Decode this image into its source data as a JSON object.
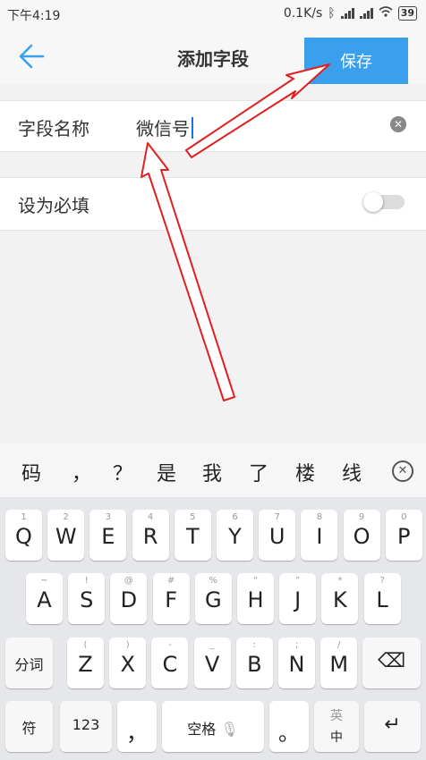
{
  "status": {
    "time": "下午4:19",
    "speed": "0.1K/s",
    "battery": "39"
  },
  "appbar": {
    "title": "添加字段",
    "save_label": "保存"
  },
  "field_name": {
    "label": "字段名称",
    "value": "微信号"
  },
  "required": {
    "label": "设为必填",
    "enabled": false
  },
  "candidates": [
    "码",
    "，",
    "？",
    "是",
    "我",
    "了",
    "楼",
    "线"
  ],
  "keyboard": {
    "row1": [
      {
        "sub": "1",
        "main": "Q"
      },
      {
        "sub": "2",
        "main": "W"
      },
      {
        "sub": "3",
        "main": "E"
      },
      {
        "sub": "4",
        "main": "R"
      },
      {
        "sub": "5",
        "main": "T"
      },
      {
        "sub": "6",
        "main": "Y"
      },
      {
        "sub": "7",
        "main": "U"
      },
      {
        "sub": "8",
        "main": "I"
      },
      {
        "sub": "9",
        "main": "O"
      },
      {
        "sub": "0",
        "main": "P"
      }
    ],
    "row2": [
      {
        "sub": "~",
        "main": "A"
      },
      {
        "sub": "!",
        "main": "S"
      },
      {
        "sub": "@",
        "main": "D"
      },
      {
        "sub": "#",
        "main": "F"
      },
      {
        "sub": "%",
        "main": "G"
      },
      {
        "sub": "“",
        "main": "H"
      },
      {
        "sub": "”",
        "main": "J"
      },
      {
        "sub": "*",
        "main": "K"
      },
      {
        "sub": "?",
        "main": "L"
      }
    ],
    "row3": [
      {
        "sub": "(",
        "main": "Z"
      },
      {
        "sub": ")",
        "main": "X"
      },
      {
        "sub": "-",
        "main": "C"
      },
      {
        "sub": "_",
        "main": "V"
      },
      {
        "sub": ":",
        "main": "B"
      },
      {
        "sub": ";",
        "main": "N"
      },
      {
        "sub": "/",
        "main": "M"
      }
    ],
    "fn": {
      "segment": "分词",
      "symbols": "符",
      "numbers": "123",
      "comma": "，",
      "space": "空格",
      "period": "。",
      "lang": "英",
      "lang_sub": "中",
      "backspace": "⌫",
      "enter": "↵"
    }
  },
  "colors": {
    "accent": "#3aa0ee",
    "arrow": "#e02020"
  }
}
